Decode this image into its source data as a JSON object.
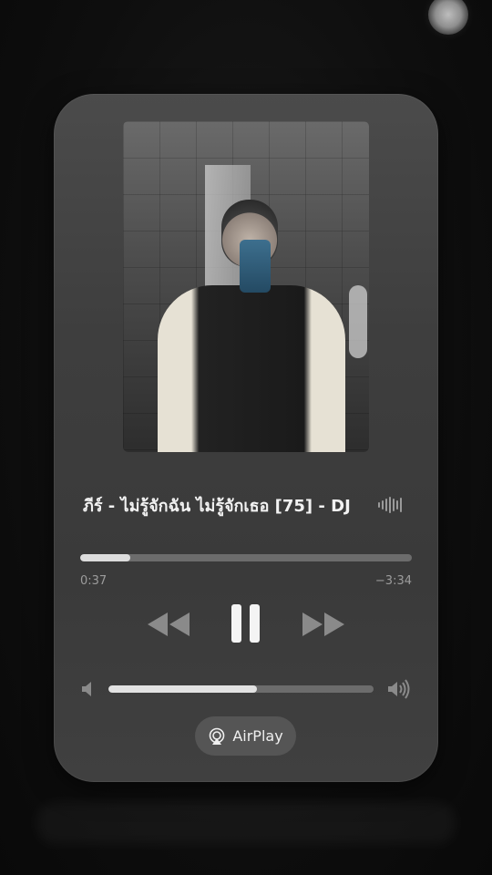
{
  "now_playing": {
    "title": "ภีร์ - ไม่รู้จักฉัน ไม่รู้จักเธอ [75] - DJ",
    "elapsed": "0:37",
    "remaining": "−3:34",
    "progress_fraction": 0.15,
    "volume_fraction": 0.56
  },
  "controls": {
    "rewind_icon": "rewind-icon",
    "pause_icon": "pause-icon",
    "forward_icon": "fast-forward-icon",
    "volume_low_icon": "speaker-low-icon",
    "volume_high_icon": "speaker-high-icon"
  },
  "airplay": {
    "label": "AirPlay",
    "icon": "airplay-icon"
  },
  "colors": {
    "card_bg": "#3e3e3e",
    "progress_fill": "#dcdcdc",
    "track_bg": "#6c6c6c",
    "text_primary": "#f2f2f2",
    "text_secondary": "#9c9c9c"
  }
}
